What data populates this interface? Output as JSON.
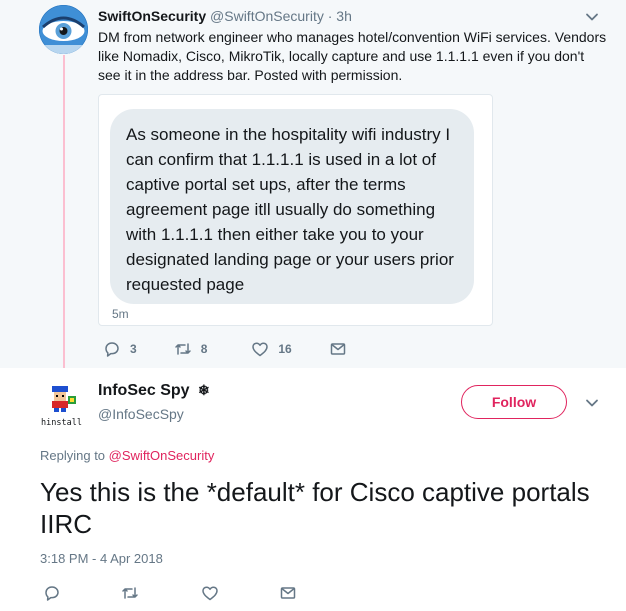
{
  "parent_tweet": {
    "display_name": "SwiftOnSecurity",
    "handle": "@SwiftOnSecurity",
    "separator": "·",
    "time": "3h",
    "text": "DM from network engineer who manages hotel/convention WiFi services. Vendors like Nomadix, Cisco, MikroTik, locally capture and use 1.1.1.1 even if you don't see it in the address bar. Posted with permission.",
    "dm_message": "As someone in the hospitality wifi industry I can confirm that 1.1.1.1 is used in a lot of captive portal set ups, after the terms agreement page itll usually do something with 1.1.1.1 then either take you to your designated landing page or your users prior requested page",
    "dm_time": "5m",
    "reply_count": "3",
    "retweet_count": "8",
    "like_count": "16",
    "colors": {
      "background": "#f5f8fa",
      "thread_line": "#fbbfd0"
    }
  },
  "reply_tweet": {
    "display_name": "InfoSec Spy",
    "badge_icon": "snowflake-icon",
    "badge_glyph": "❄",
    "handle": "@InfoSecSpy",
    "avatar_label": "hinstall",
    "follow_label": "Follow",
    "replying_prefix": "Replying to",
    "replying_mention": "@SwiftOnSecurity",
    "text": "Yes this is the *default* for Cisco captive portals IIRC",
    "timestamp": "3:18 PM - 4 Apr 2018",
    "colors": {
      "accent": "#e0245e",
      "secondary_text": "#657786"
    }
  }
}
